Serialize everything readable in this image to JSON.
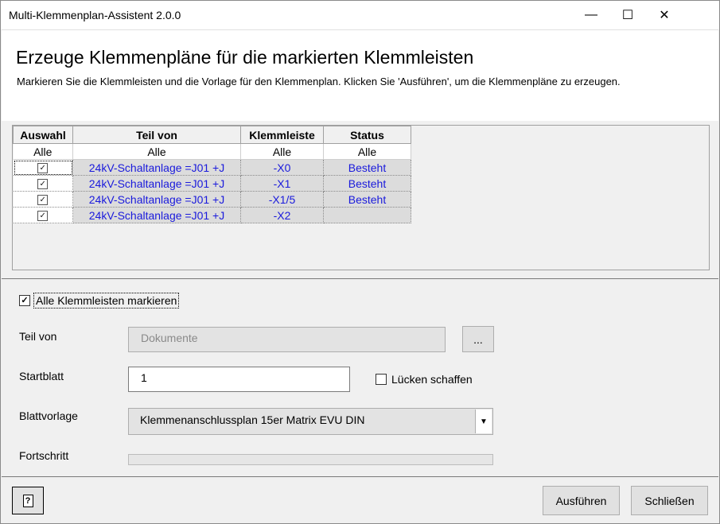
{
  "window": {
    "title": "Multi-Klemmenplan-Assistent 2.0.0",
    "minimize_glyph": "—",
    "maximize_glyph": "☐",
    "close_glyph": "✕"
  },
  "header": {
    "title": "Erzeuge Klemmenpläne für die markierten Klemmleisten",
    "subtitle": "Markieren Sie die Klemmleisten und die Vorlage für den Klemmenplan. Klicken Sie 'Ausführen', um die Klemmenpläne zu erzeugen."
  },
  "grid": {
    "columns": [
      "Auswahl",
      "Teil von",
      "Klemmleiste",
      "Status"
    ],
    "filter_row": [
      "Alle",
      "Alle",
      "Alle",
      "Alle"
    ],
    "rows": [
      {
        "checked": true,
        "teil_von": "24kV-Schaltanlage =J01 +J",
        "klemmleiste": "-X0",
        "status": "Besteht"
      },
      {
        "checked": true,
        "teil_von": "24kV-Schaltanlage =J01 +J",
        "klemmleiste": "-X1",
        "status": "Besteht"
      },
      {
        "checked": true,
        "teil_von": "24kV-Schaltanlage =J01 +J",
        "klemmleiste": "-X1/5",
        "status": "Besteht"
      },
      {
        "checked": true,
        "teil_von": "24kV-Schaltanlage =J01 +J",
        "klemmleiste": "-X2",
        "status": ""
      }
    ],
    "row_text_color": "#1a1adc"
  },
  "form": {
    "mark_all_label": "Alle Klemmleisten markieren",
    "mark_all_checked": true,
    "teil_von_label": "Teil von",
    "teil_von_placeholder": "Dokumente",
    "browse_label": "...",
    "startblatt_label": "Startblatt",
    "startblatt_value": "1",
    "luecken_label": "Lücken schaffen",
    "luecken_checked": false,
    "blattvorlage_label": "Blattvorlage",
    "blattvorlage_value": "Klemmenanschlussplan 15er Matrix EVU DIN",
    "fortschritt_label": "Fortschritt",
    "fortschritt_value": 0
  },
  "footer": {
    "help_glyph": "?",
    "run_label": "Ausführen",
    "close_label": "Schließen"
  }
}
